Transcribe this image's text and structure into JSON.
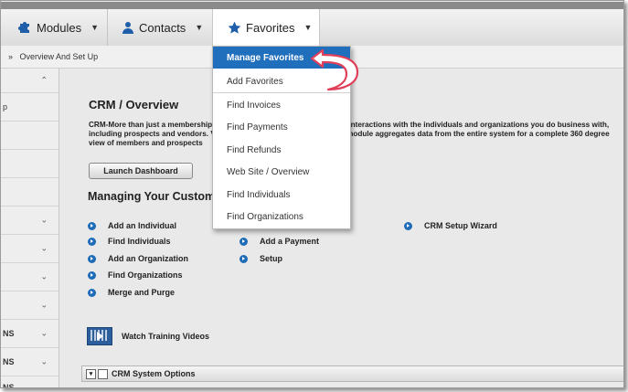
{
  "nav": {
    "modules": "Modules",
    "contacts": "Contacts",
    "favorites": "Favorites"
  },
  "breadcrumb": {
    "sep": "»",
    "text": "Overview And Set Up"
  },
  "sidebar": {
    "rows": [
      "p",
      "NS",
      "NS",
      "NS"
    ]
  },
  "main": {
    "title": "CRM / Overview",
    "desc_lines": [
      "CRM-More than just a membership",
      "including prospects and vendors.",
      "view of members and prospects"
    ],
    "desc_right_lines": [
      "all interactions with the individuals and organizations you do business with,",
      "M module aggregates data from the entire system for a complete 360 degree"
    ],
    "v_char": "V",
    "dashboard_button": "Launch Dashboard",
    "section_title": "Managing Your Custom",
    "links_col1": [
      "Add an Individual",
      "Find Individuals",
      "Add an Organization",
      "Find Organizations",
      "Merge and Purge"
    ],
    "links_col2": [
      "Add a Payment",
      "Setup"
    ],
    "links_col3": [
      "CRM Setup Wizard"
    ],
    "video_label": "Watch Training Videos",
    "system_options": "CRM System Options"
  },
  "favorites_menu": {
    "items": [
      "Manage Favorites",
      "Add Favorites",
      "Find Invoices",
      "Find Payments",
      "Find Refunds",
      "Web Site / Overview",
      "Find Individuals",
      "Find Organizations"
    ]
  },
  "colors": {
    "accent": "#1f6fbd",
    "arrow": "#e0405a"
  }
}
